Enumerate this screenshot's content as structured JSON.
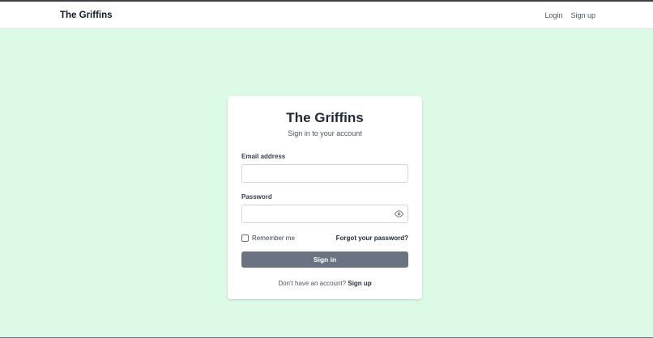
{
  "navbar": {
    "brand": "The Griffins",
    "links": [
      {
        "label": "Login"
      },
      {
        "label": "Sign up"
      }
    ]
  },
  "login_card": {
    "title": "The Griffins",
    "subtitle": "Sign in to your account",
    "email": {
      "label": "Email address",
      "value": "",
      "placeholder": ""
    },
    "password": {
      "label": "Password",
      "value": "",
      "placeholder": "",
      "toggle_icon": "eye-icon"
    },
    "remember_me": {
      "label": "Remember me",
      "checked": false
    },
    "forgot_password": "Forgot your password?",
    "submit_label": "Sign in",
    "signup_prompt": "Don't have an account?",
    "signup_link": "Sign up"
  },
  "colors": {
    "page_background": "#dcfae6",
    "navbar_background": "#ffffff",
    "card_background": "#ffffff",
    "button_background": "#6b7280",
    "button_text": "#ffffff",
    "heading_text": "#1f2937"
  }
}
